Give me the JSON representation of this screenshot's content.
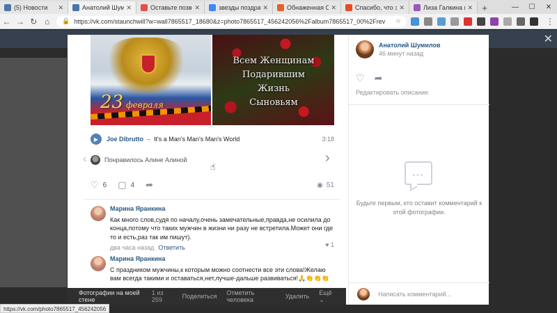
{
  "browser": {
    "tabs": [
      {
        "title": "(5) Новости",
        "color": "#4a76a8"
      },
      {
        "title": "Анатолий Шумилов",
        "color": "#4a76a8"
      },
      {
        "title": "Оставьте позвоно",
        "color": "#d9534f"
      },
      {
        "title": "звезды поздравле",
        "color": "#4285f4"
      },
      {
        "title": "Обнаженная Семь",
        "color": "#e2622b"
      },
      {
        "title": "Спасибо, что заст",
        "color": "#e44d26"
      },
      {
        "title": "Лиза Галкина позд",
        "color": "#9b59b6"
      }
    ],
    "new_tab": "+",
    "url": "https://vk.com/staunchwill?w=wall7865517_18680&z=photo7865517_456242056%2Falbum7865517_00%2Frev"
  },
  "photo": {
    "image_date": "23",
    "image_month": "февраля",
    "image_lines": [
      "Всем Женщинам",
      "Подарившим",
      "Жизнь",
      "Сыновьям"
    ]
  },
  "audio": {
    "artist": "Joe Dibrutto",
    "separator": "–",
    "track": "It's a Man's Man's Man's World",
    "duration": "3:18"
  },
  "liked_by": "Понравилось Алине Алиной",
  "stats": {
    "likes": "6",
    "comments": "4",
    "views": "51"
  },
  "comments": [
    {
      "name": "Марина Яранкина",
      "text": "Как много слов,судя по началу,очень замечательные,правда,не осилила до конца,потому что таких мужчин в жизни ни разу не встретила.Может они где то и есть,раз так им пишут).",
      "time": "два часа назад",
      "reply": "Ответить",
      "likes": "1"
    },
    {
      "name": "Марина Яранкина",
      "text": "С праздником мужчины,к которым можно соотнести все эти слова!Желаю вам всегда такими и оставаться,нет,лучше-дальше развиваться!🙏👏👏👏",
      "time": "",
      "reply": "",
      "likes": ""
    }
  ],
  "bottom_bar": {
    "album": "Фотографии на моей стене",
    "counter": "1 из 259",
    "share": "Поделиться",
    "tag": "Отметить человека",
    "delete": "Удалить",
    "more": "Ещё"
  },
  "author": {
    "name": "Анатолий Шумилов",
    "time": "46 минут назад"
  },
  "edit_description": "Редактировать описание",
  "no_comments": "Будьте первым, кто оставит комментарий к этой фотографии.",
  "new_comment_placeholder": "Написать комментарий...",
  "status_link": "https://vk.com/photo7865517_456242056"
}
